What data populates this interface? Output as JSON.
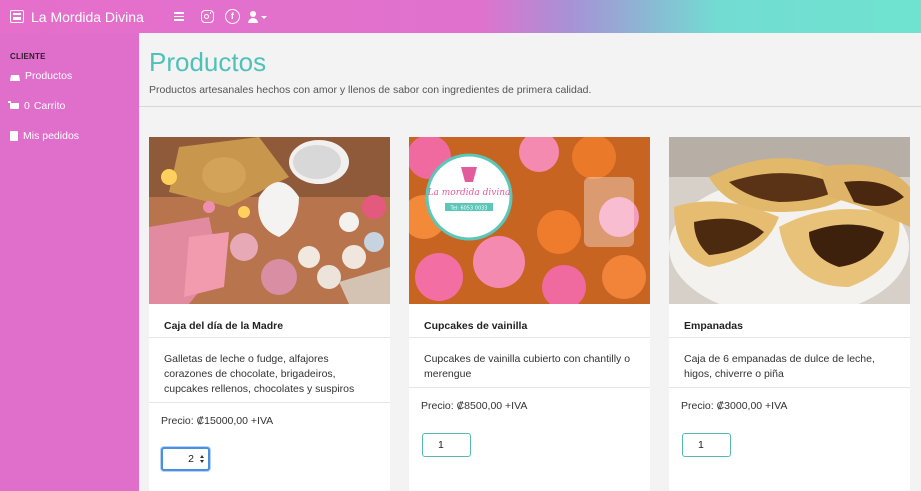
{
  "app": {
    "brand": "La Mordida Divina",
    "accent_color": "#4fc1b9",
    "sidebar_color": "#e06fcc",
    "icons": [
      "menu-icon",
      "instagram-icon",
      "facebook-icon",
      "user-icon"
    ]
  },
  "topbar": {
    "facebook_glyph": "f"
  },
  "sidebar": {
    "heading": "CLIENTE",
    "items": [
      {
        "label": "Productos",
        "icon": "basket-icon"
      },
      {
        "label": "Carrito",
        "icon": "cart-icon",
        "count": "0"
      },
      {
        "label": "Mis pedidos",
        "icon": "document-icon"
      }
    ]
  },
  "main": {
    "title": "Productos",
    "subtitle": "Productos artesanales hechos con amor y llenos de sabor con ingredientes de primera calidad.",
    "products": [
      {
        "name": "Caja del día de la Madre",
        "description": "Galletas de leche o fudge, alfajores corazones de chocolate, brigadeiros, cupcakes rellenos, chocolates y suspiros",
        "price": "Precio: ₡15000,00 +IVA",
        "quantity": "2"
      },
      {
        "name": "Cupcakes de vainilla",
        "description": "Cupcakes de vainilla cubierto con chantilly o merengue",
        "price": "Precio: ₡8500,00 +IVA",
        "quantity": "1",
        "image_logo_text": "La mordida divina",
        "image_logo_phone": "Tel: 6053 0033"
      },
      {
        "name": "Empanadas",
        "description": "Caja de 6 empanadas de dulce de leche, higos, chiverre o piña",
        "price": "Precio: ₡3000,00 +IVA",
        "quantity": "1"
      }
    ]
  }
}
